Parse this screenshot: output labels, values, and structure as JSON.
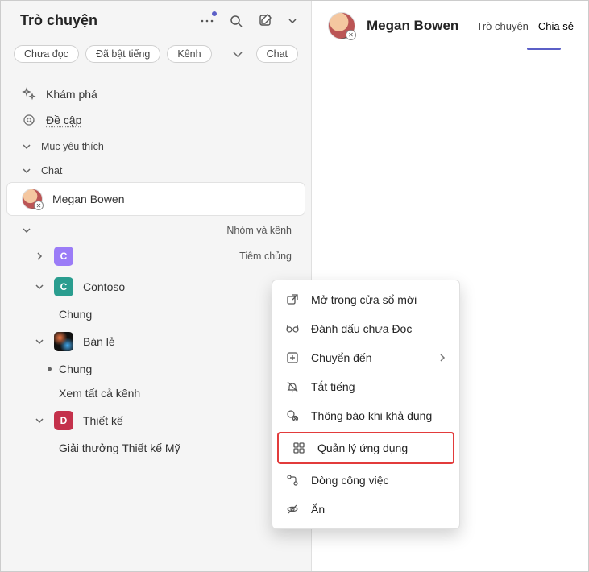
{
  "header": {
    "title": "Trò chuyện"
  },
  "filters": {
    "items": [
      "Chưa đọc",
      "Đã bật tiếng",
      "Kênh",
      "Chat"
    ]
  },
  "nav": {
    "discover": "Khám phá",
    "mentions": "Đề cập",
    "favorites_section": "Mục yêu thích",
    "chat_section": "Chat",
    "selected_chat": "Megan Bowen",
    "groups_section": "Nhóm và kênh",
    "vaccine": "Tiêm chủng",
    "contoso": "Contoso",
    "contoso_general": "Chung",
    "retail": "Bán lẻ",
    "retail_general": "Chung",
    "retail_all": "Xem tất cả kênh",
    "design": "Thiết kế",
    "design_award": "Giải thưởng Thiết kế Mỹ"
  },
  "right": {
    "name": "Megan Bowen",
    "tab_chat": "Trò chuyện",
    "tab_share": "Chia sẻ"
  },
  "menu": {
    "open_new_window": "Mở trong cửa sổ mới",
    "mark_unread": "Đánh dấu chưa Đọc",
    "move_to": "Chuyển đến",
    "mute": "Tắt tiếng",
    "notify_available": "Thông báo khi khả dụng",
    "manage_apps": "Quản lý ứng dụng",
    "workflow": "Dòng công việc",
    "hide": "Ẩn"
  }
}
